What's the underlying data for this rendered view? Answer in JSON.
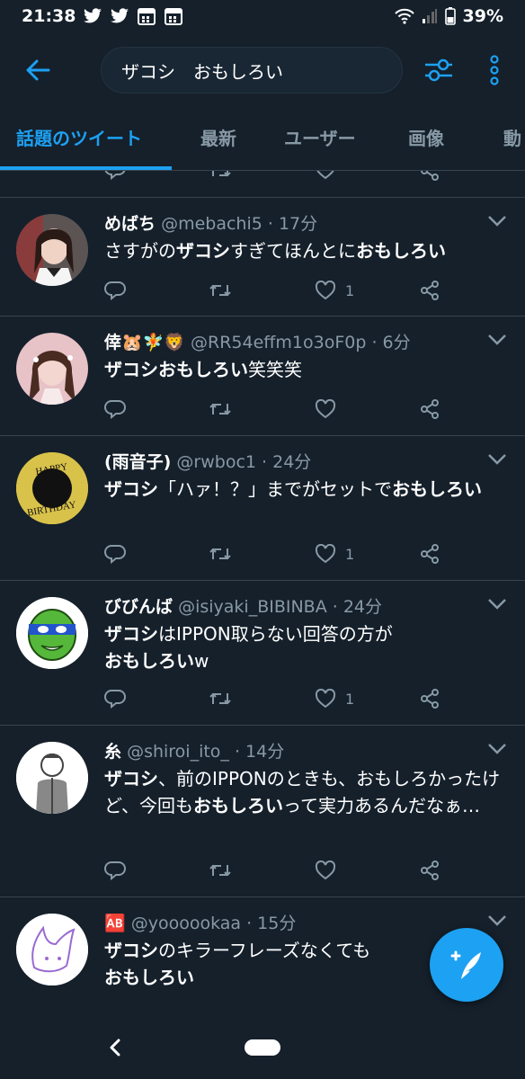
{
  "status_bar": {
    "time": "21:38",
    "battery": "39%"
  },
  "search": {
    "query": "ザコシ　おもしろい"
  },
  "tabs": [
    {
      "label": "話題のツイート"
    },
    {
      "label": "最新"
    },
    {
      "label": "ユーザー"
    },
    {
      "label": "画像"
    },
    {
      "label": "動"
    }
  ],
  "tweets": [
    {
      "name": "めばち",
      "handle": "@mebachi5 · 17分",
      "text_parts": [
        "さすがの",
        "ザコシ",
        "すぎてほんとに",
        "おもしろい"
      ],
      "likes": "1"
    },
    {
      "name": "倖🐹🧚🦁",
      "handle": "@RR54effm1o3oF0p · 6分",
      "text_parts": [
        "ザコシおもしろい",
        "笑笑笑"
      ],
      "likes": ""
    },
    {
      "name": "(雨音子)",
      "handle": "@rwboc1 · 24分",
      "text_parts": [
        "ザコシ",
        "「ハァ！？」までがセットで",
        "おもしろい"
      ],
      "likes": "1"
    },
    {
      "name": "びびんば",
      "handle": "@isiyaki_BIBINBA · 24分",
      "text_parts": [
        "ザコシ",
        "はIPPON取らない回答の方が",
        "おもしろい",
        "w"
      ],
      "likes": "1"
    },
    {
      "name": "糸",
      "handle": "@shiroi_ito_ · 14分",
      "text_parts": [
        "ザコシ",
        "、前のIPPONのときも、おもしろかったけど、今回も",
        "おもしろい",
        "って実力あるんだなぁ…"
      ],
      "likes": ""
    },
    {
      "name": "🆎",
      "handle": "@yoooookaa · 15分",
      "text_parts": [
        "ザコシ",
        "のキラーフレーズなくても",
        "おもしろい",
        ""
      ],
      "likes": ""
    }
  ],
  "avatar_texts": {
    "birthday_top": "HAPPY",
    "birthday_bottom": "BIRTHDAY"
  },
  "icons": [
    "back-arrow-icon",
    "filter-icon",
    "more-vert-icon",
    "reply-icon",
    "retweet-icon",
    "like-icon",
    "share-icon",
    "chevron-down-icon",
    "compose-icon"
  ],
  "colors": {
    "background": "#15202b",
    "accent": "#1da1f2",
    "secondary_text": "#8899a6",
    "divider": "#38444d"
  }
}
